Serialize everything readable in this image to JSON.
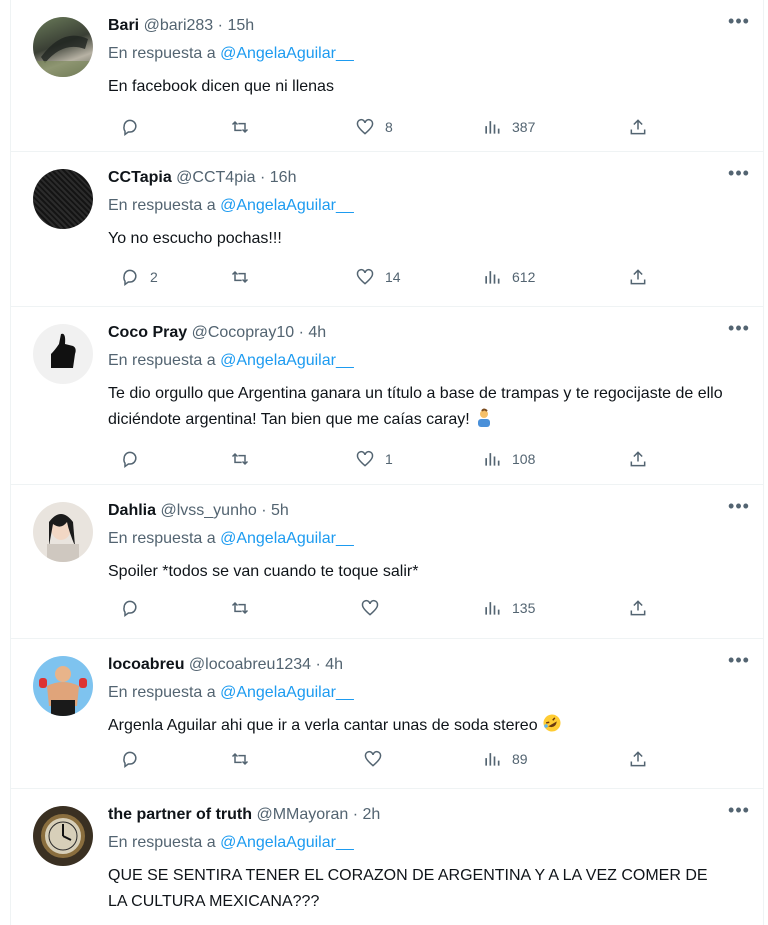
{
  "reply_prefix": "En respuesta a",
  "tweets": [
    {
      "name": "Bari",
      "handle": "@bari283",
      "time": "15h",
      "mention": "@AngelaAguilar__",
      "text": "En facebook dicen que ni llenas",
      "replies": "",
      "retweets": "",
      "likes": "8",
      "views": "387"
    },
    {
      "name": "CCTapia",
      "handle": "@CCT4pia",
      "time": "16h",
      "mention": "@AngelaAguilar__",
      "text": "Yo no escucho pochas!!!",
      "replies": "2",
      "retweets": "",
      "likes": "14",
      "views": "612"
    },
    {
      "name": "Coco Pray",
      "handle": "@Cocopray10",
      "time": "4h",
      "mention": "@AngelaAguilar__",
      "text": "Te dio orgullo que Argentina ganara un título a base de trampas y te regocijaste de ello diciéndote argentina! Tan bien que me caías caray!",
      "replies": "",
      "retweets": "",
      "likes": "1",
      "views": "108"
    },
    {
      "name": "Dahlia",
      "handle": "@lvss_yunho",
      "time": "5h",
      "mention": "@AngelaAguilar__",
      "text": "Spoiler *todos se van cuando te toque salir*",
      "replies": "",
      "retweets": "",
      "likes": "",
      "views": "135"
    },
    {
      "name": "locoabreu",
      "handle": "@locoabreu1234",
      "time": "4h",
      "mention": "@AngelaAguilar__",
      "text": "Argenla Aguilar ahi que ir a verla cantar unas de soda stereo",
      "replies": "",
      "retweets": "",
      "likes": "",
      "views": "89"
    },
    {
      "name": "the partner of truth",
      "handle": "@MMayoran",
      "time": "2h",
      "mention": "@AngelaAguilar__",
      "text": "QUE SE SENTIRA TENER EL CORAZON DE ARGENTINA Y A LA VEZ COMER DE LA CULTURA MEXICANA???",
      "replies": "",
      "retweets": "",
      "likes": "",
      "views": ""
    }
  ],
  "more_icon": "•••",
  "colors": {
    "link": "#1d9bf0",
    "muted": "#536471",
    "text": "#0f1419",
    "border": "#eff3f4"
  }
}
